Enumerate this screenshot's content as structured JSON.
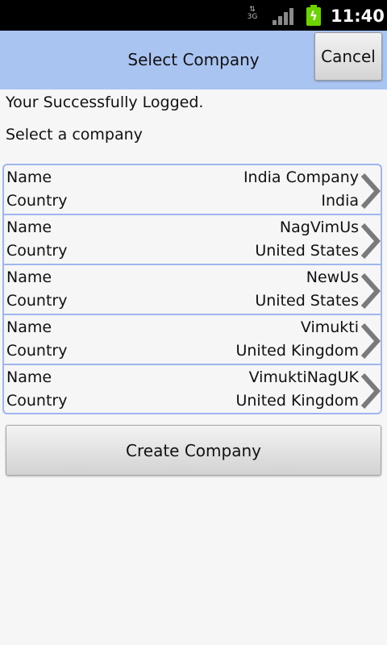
{
  "status_bar": {
    "network": "3G",
    "time": "11:40"
  },
  "header": {
    "title": "Select Company",
    "cancel_label": "Cancel"
  },
  "messages": {
    "logged_in": "Your Successfully Logged.",
    "select_prompt": "Select a company"
  },
  "companies": [
    {
      "name_label": "Name",
      "name": "India Company",
      "country_label": "Country",
      "country": "India"
    },
    {
      "name_label": "Name",
      "name": "NagVimUs",
      "country_label": "Country",
      "country": "United States"
    },
    {
      "name_label": "Name",
      "name": "NewUs",
      "country_label": "Country",
      "country": "United States"
    },
    {
      "name_label": "Name",
      "name": "Vimukti",
      "country_label": "Country",
      "country": "United Kingdom"
    },
    {
      "name_label": "Name",
      "name": "VimuktiNagUK",
      "country_label": "Country",
      "country": "United Kingdom"
    }
  ],
  "create_button_label": "Create Company",
  "colors": {
    "title_bar": "#aac4f2",
    "list_border": "#9fb6ee",
    "background": "#f6f6f6"
  },
  "icons": [
    "network-3g-icon",
    "signal-icon",
    "battery-charging-icon",
    "chevron-right-icon"
  ]
}
